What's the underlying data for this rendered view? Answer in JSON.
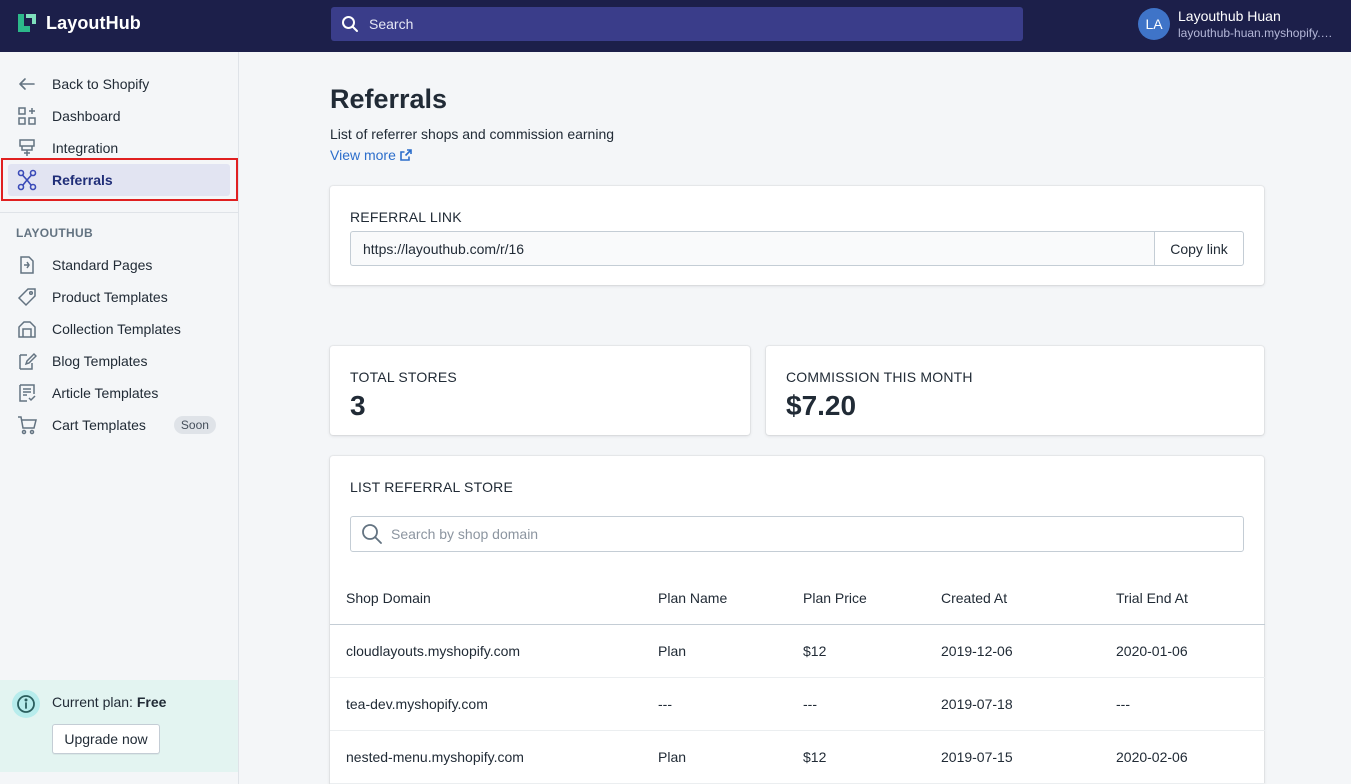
{
  "app": {
    "name": "LayoutHub",
    "brand_color": "#1c1f4a",
    "accent": "#2cb88a"
  },
  "search": {
    "placeholder": "Search"
  },
  "user": {
    "initials": "LA",
    "name": "Layouthub Huan",
    "shop": "layouthub-huan.myshopify.com"
  },
  "sidebar": {
    "top_items": [
      {
        "label": "Back to Shopify",
        "icon": "arrow-left-icon"
      },
      {
        "label": "Dashboard",
        "icon": "dashboard-icon"
      },
      {
        "label": "Integration",
        "icon": "integration-icon"
      },
      {
        "label": "Referrals",
        "icon": "referrals-icon",
        "active": true
      }
    ],
    "section_label": "LAYOUTHUB",
    "section_items": [
      {
        "label": "Standard Pages",
        "icon": "page-import-icon"
      },
      {
        "label": "Product Templates",
        "icon": "tag-icon"
      },
      {
        "label": "Collection Templates",
        "icon": "collection-icon"
      },
      {
        "label": "Blog Templates",
        "icon": "blog-edit-icon"
      },
      {
        "label": "Article Templates",
        "icon": "article-icon"
      },
      {
        "label": "Cart Templates",
        "icon": "cart-icon",
        "badge": "Soon"
      }
    ],
    "plan": {
      "prefix": "Current plan:",
      "value": "Free",
      "upgrade_label": "Upgrade now"
    }
  },
  "page": {
    "title": "Referrals",
    "subtitle": "List of referrer shops and commission earning",
    "view_more": "View more"
  },
  "referral_link": {
    "label": "REFERRAL LINK",
    "value": "https://layouthub.com/r/16",
    "copy_label": "Copy link"
  },
  "stats": {
    "total_stores": {
      "label": "TOTAL STORES",
      "value": "3"
    },
    "commission": {
      "label": "COMMISSION THIS MONTH",
      "value": "$7.20"
    }
  },
  "stores": {
    "label": "LIST REFERRAL STORE",
    "search_placeholder": "Search by shop domain",
    "columns": [
      "Shop Domain",
      "Plan Name",
      "Plan Price",
      "Created At",
      "Trial End At"
    ],
    "rows": [
      [
        "cloudlayouts.myshopify.com",
        "Plan",
        "$12",
        "2019-12-06",
        "2020-01-06"
      ],
      [
        "tea-dev.myshopify.com",
        "---",
        "---",
        "2019-07-18",
        "---"
      ],
      [
        "nested-menu.myshopify.com",
        "Plan",
        "$12",
        "2019-07-15",
        "2020-02-06"
      ]
    ]
  }
}
